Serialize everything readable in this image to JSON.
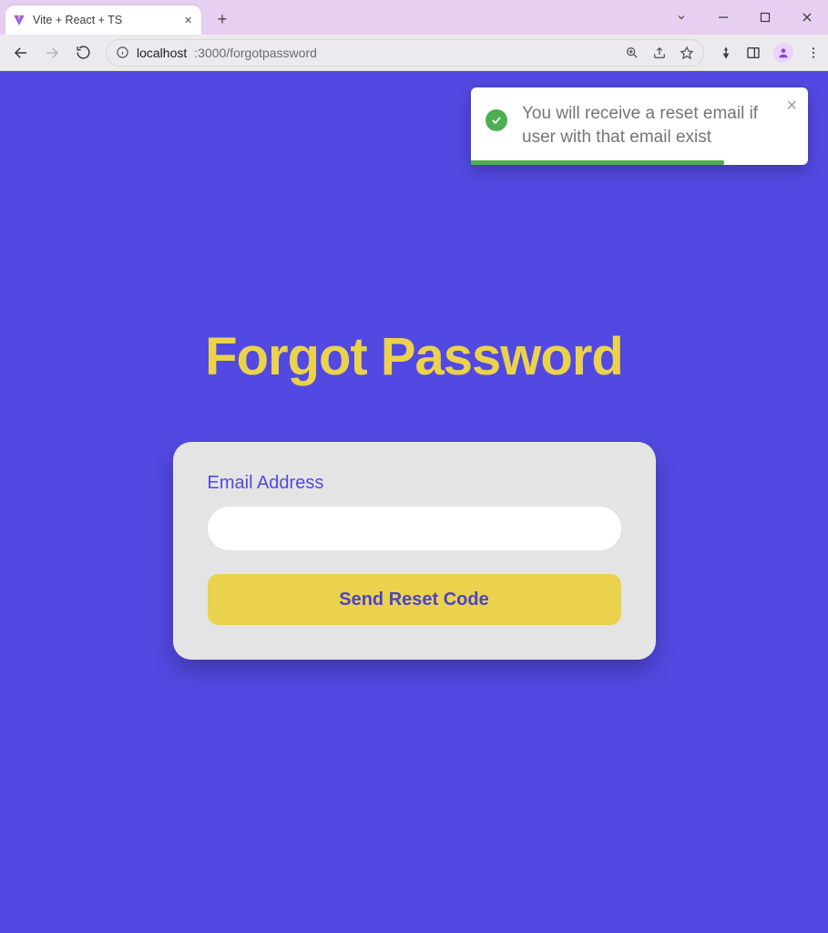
{
  "window": {
    "tab_title": "Vite + React + TS"
  },
  "address": {
    "host": "localhost",
    "port_path": ":3000/forgotpassword"
  },
  "toast": {
    "message": "You will receive a reset email if user with that email exist"
  },
  "page": {
    "heading": "Forgot Password"
  },
  "form": {
    "email_label": "Email Address",
    "email_value": "",
    "submit_label": "Send Reset Code"
  }
}
